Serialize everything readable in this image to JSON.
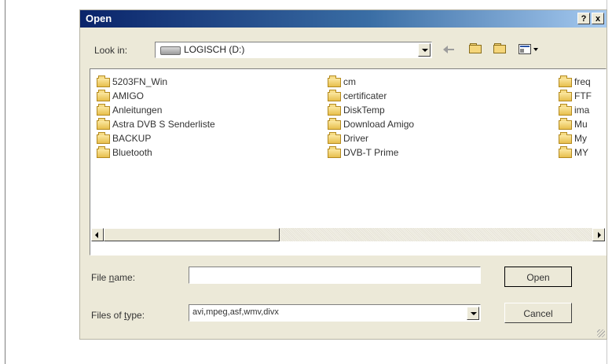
{
  "dialog": {
    "title": "Open",
    "help_label": "?",
    "close_label": "x"
  },
  "lookin": {
    "label": "Look in:",
    "value": "LOGISCH (D:)"
  },
  "toolbar": {
    "icons": [
      "back-icon",
      "up-folder-icon",
      "new-folder-icon",
      "views-icon"
    ]
  },
  "files": {
    "col1": [
      "5203FN_Win",
      "AMIGO",
      "Anleitungen",
      "Astra DVB S Senderliste",
      "BACKUP",
      "Bluetooth"
    ],
    "col2": [
      "cm",
      "certificater",
      "DiskTemp",
      "Download Amigo",
      "Driver",
      "DVB-T Prime"
    ],
    "col3": [
      "freq",
      "FTF",
      "ima",
      "Mu",
      "My",
      "MY"
    ]
  },
  "filename": {
    "label_pre": "File ",
    "label_key": "n",
    "label_post": "ame:",
    "value": ""
  },
  "filetype": {
    "label_pre": "Files of ",
    "label_key": "t",
    "label_post": "ype:",
    "value": "avi,mpeg,asf,wmv,divx"
  },
  "buttons": {
    "open": "Open",
    "cancel": "Cancel"
  },
  "colors": {
    "dialog_bg": "#ece9d8",
    "title_start": "#0a246a",
    "title_end": "#a6caf0",
    "folder": "#f5d67b"
  }
}
